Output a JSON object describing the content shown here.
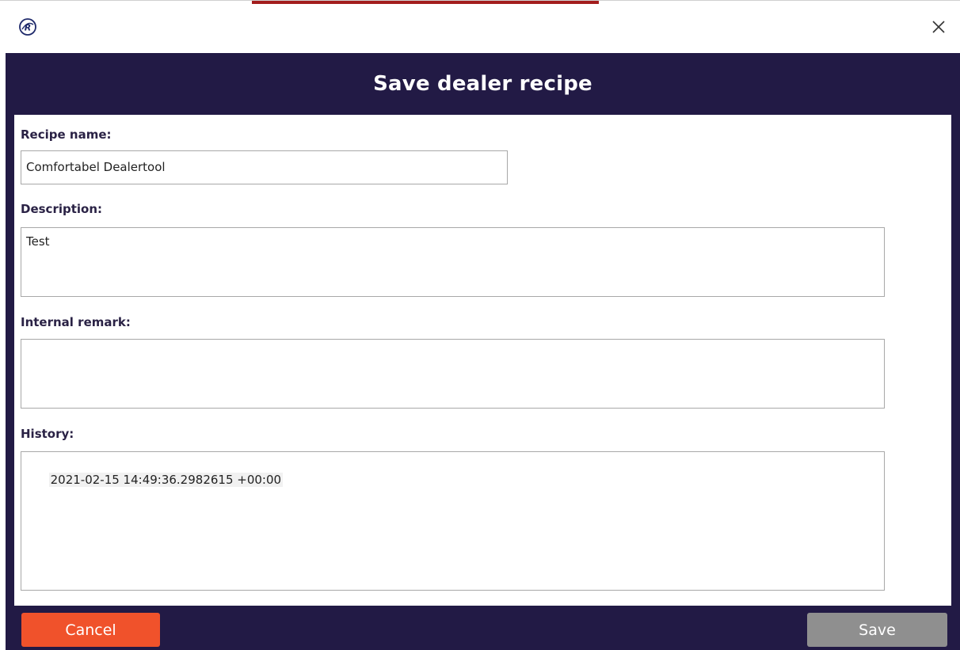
{
  "window": {
    "title": "Save dealer recipe",
    "close_icon": "close-icon",
    "app_icon": "app-logo-icon"
  },
  "form": {
    "recipe_name_label": "Recipe name:",
    "recipe_name_value": "Comfortabel Dealertool",
    "description_label": "Description:",
    "description_value": "Test",
    "internal_remark_label": "Internal remark:",
    "internal_remark_value": "",
    "history_label": "History:",
    "history_entries": [
      "2021-02-15 14:49:36.2982615 +00:00"
    ]
  },
  "buttons": {
    "cancel_label": "Cancel",
    "save_label": "Save"
  },
  "colors": {
    "header_bg": "#221a45",
    "cancel_bg": "#f0522b",
    "save_bg": "#8f8f8f",
    "accent": "#a31d1d"
  }
}
